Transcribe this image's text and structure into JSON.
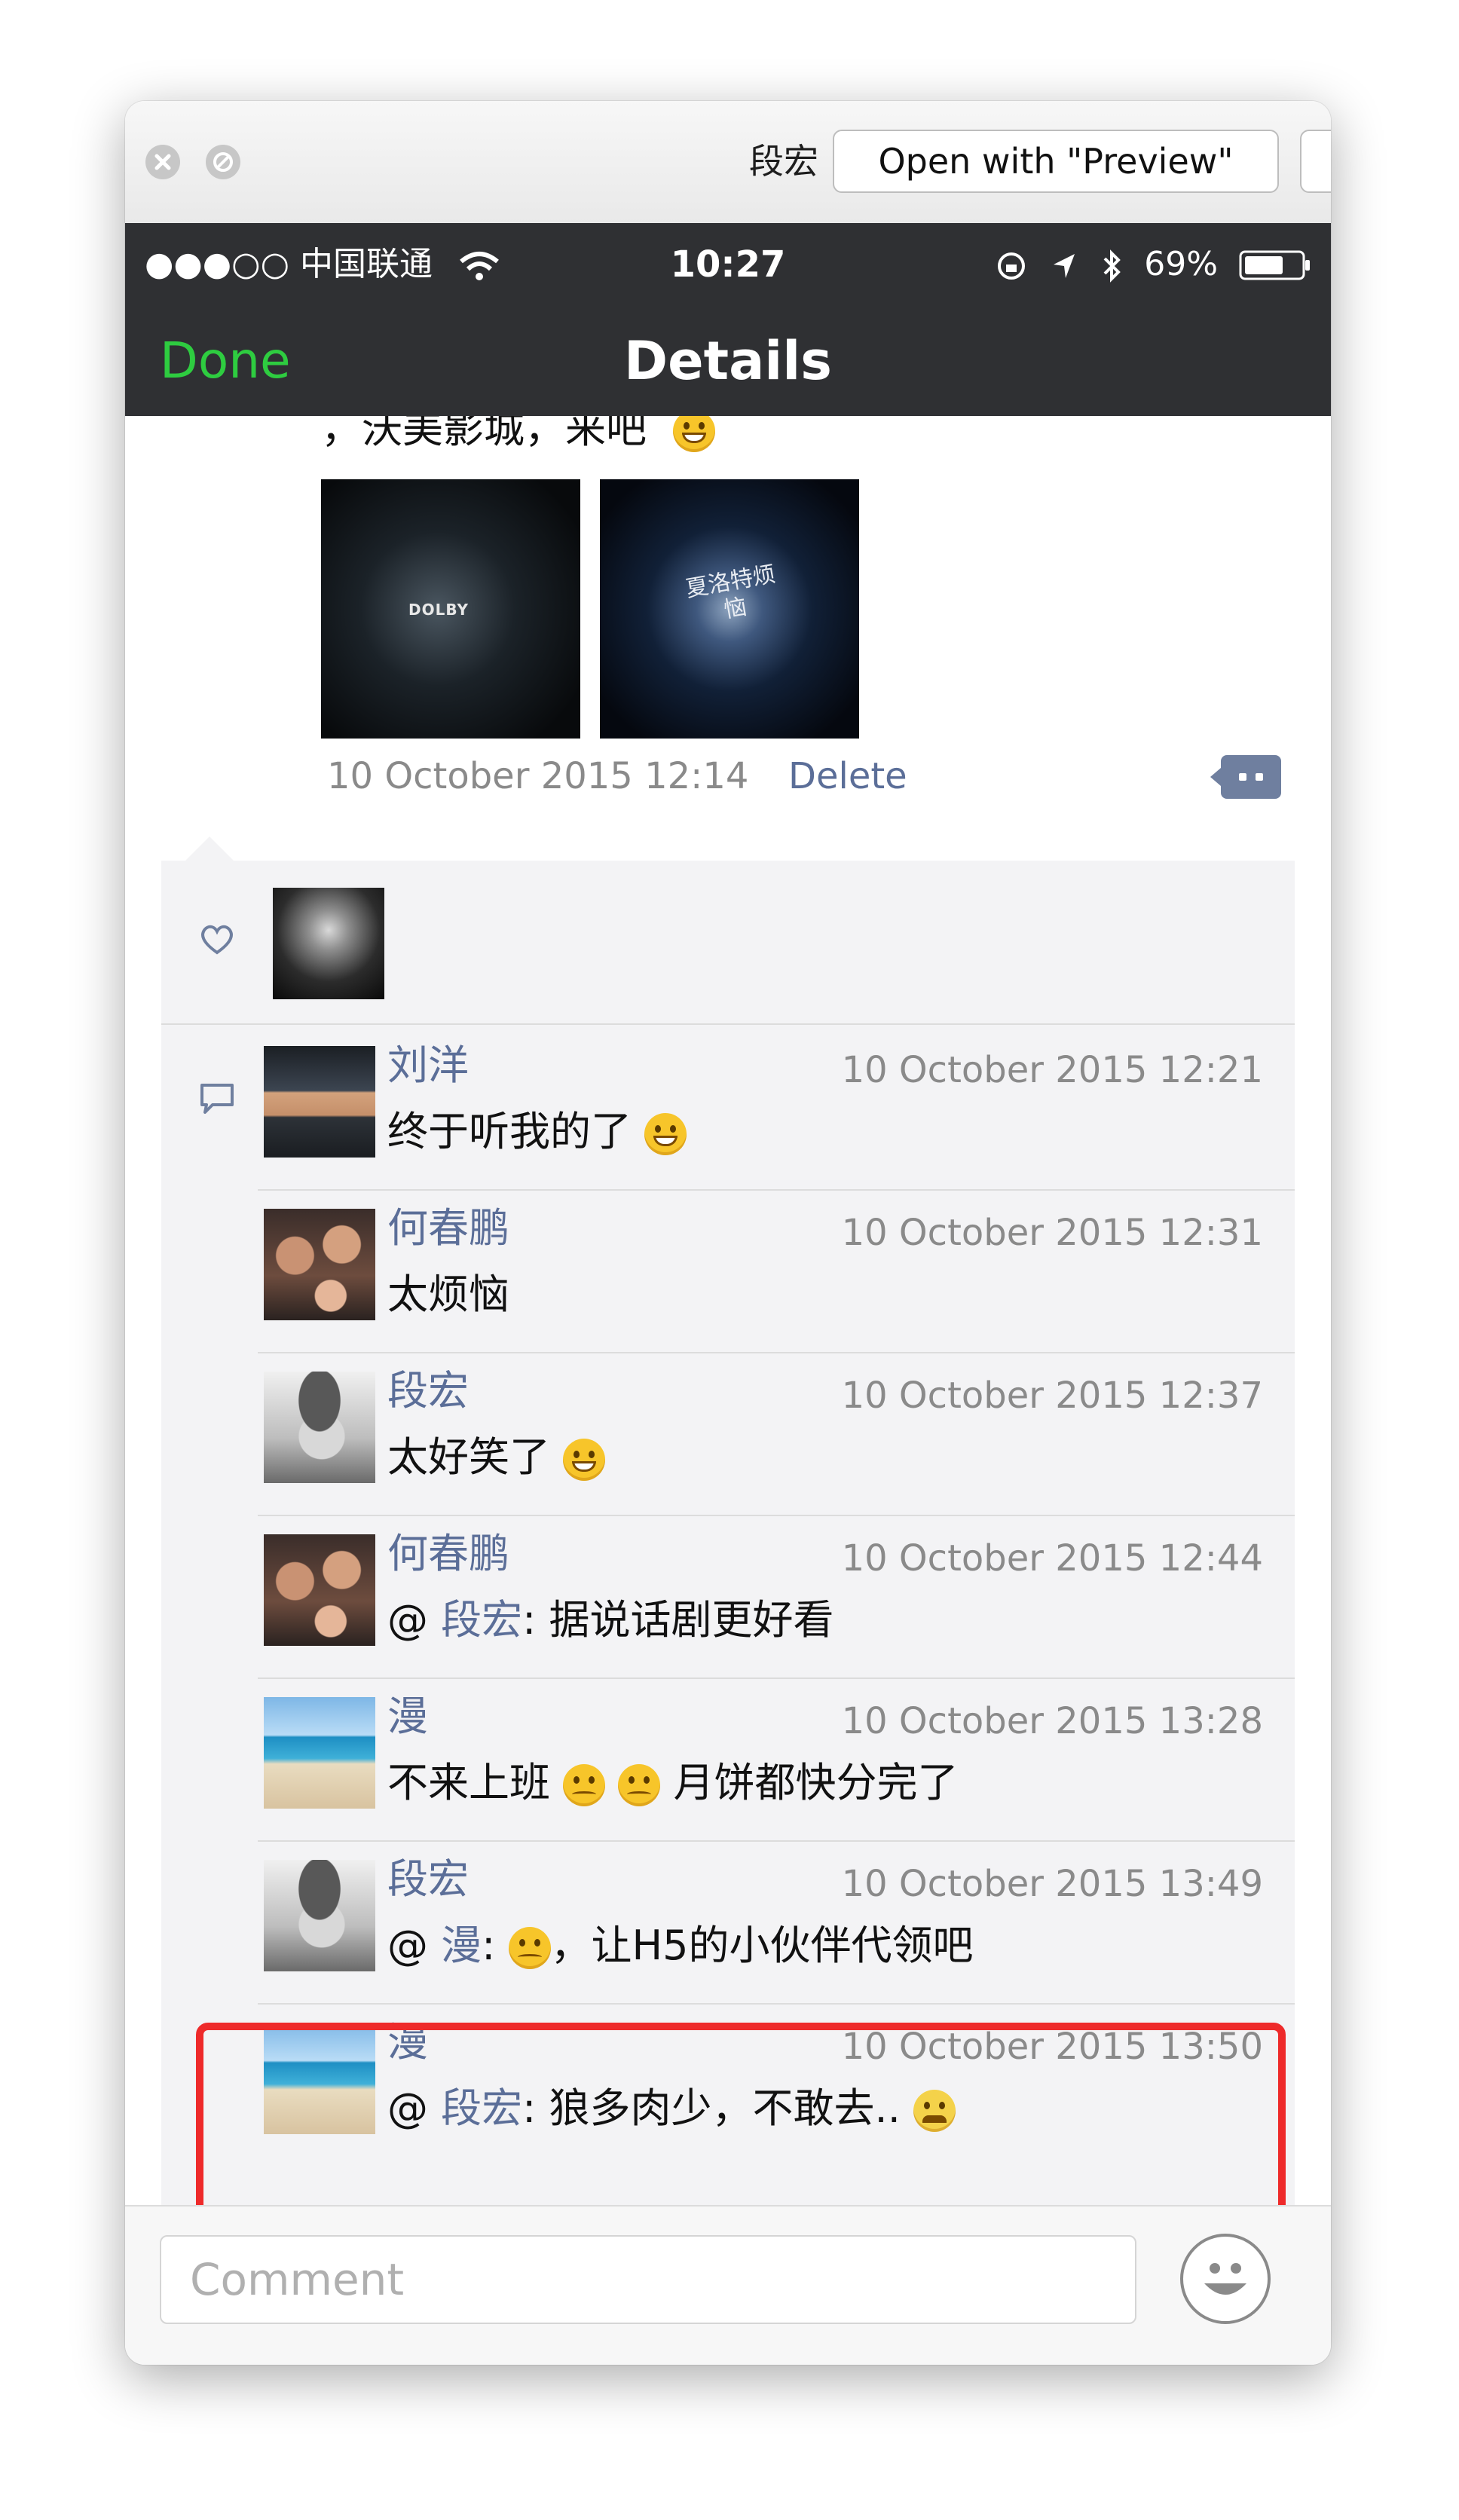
{
  "window": {
    "title": "段宏",
    "open_button": "Open with \"Preview\"",
    "share_icon": "share-icon"
  },
  "status": {
    "signal": "●●●○○ 中国联通",
    "time": "10:27",
    "battery": "69%"
  },
  "nav": {
    "done": "Done",
    "title": "Details"
  },
  "post": {
    "text": "，沃美影城，来吧",
    "photo1_logo": "DOLBY",
    "photo2_logo": "夏洛特烦恼",
    "timestamp": "10 October 2015 12:14",
    "delete": "Delete"
  },
  "comments": [
    {
      "name": "刘洋",
      "time": "10 October 2015 12:21",
      "text": "终于听我的了"
    },
    {
      "name": "何春鹏",
      "time": "10 October 2015 12:31",
      "text": " 太烦恼"
    },
    {
      "name": "段宏",
      "time": "10 October 2015 12:37",
      "text": "太好笑了"
    },
    {
      "name": "何春鹏",
      "time": "10 October 2015 12:44",
      "at": "@",
      "mention": "段宏",
      "text": ": 据说话剧更好看"
    },
    {
      "name": "漫",
      "time": "10 October 2015 13:28",
      "text_a": "不来上班",
      "text": "月饼都快分完了"
    },
    {
      "name": "段宏",
      "time": "10 October 2015 13:49",
      "at": "@",
      "mention": "漫",
      "text_a": ":",
      "text": "，让H5的小伙伴代领吧"
    },
    {
      "name": "漫",
      "time": "10 October 2015 13:50",
      "at": "@",
      "mention": "段宏",
      "text": ": 狼多肉少，不敢去.."
    }
  ],
  "footer": {
    "placeholder": "Comment"
  },
  "colors": {
    "done_green": "#2ecc40",
    "link_blue": "#5b6e98",
    "highlight_red": "#ee2a2a",
    "navbar": "#2f3033"
  }
}
